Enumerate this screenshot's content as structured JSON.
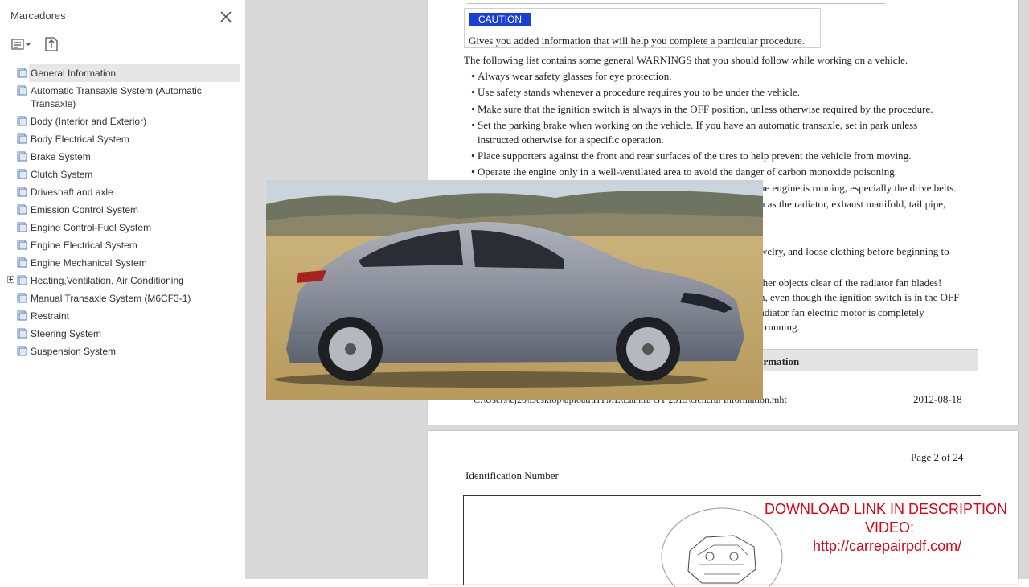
{
  "sidebar": {
    "title": "Marcadores",
    "bookmarks": [
      {
        "label": "General Information",
        "selected": true
      },
      {
        "label": "Automatic Transaxle System (Automatic",
        "label2": "Transaxle)"
      },
      {
        "label": "Body (Interior and Exterior)"
      },
      {
        "label": "Body Electrical System"
      },
      {
        "label": "Brake System"
      },
      {
        "label": "Clutch System"
      },
      {
        "label": "Driveshaft and axle"
      },
      {
        "label": "Emission Control System"
      },
      {
        "label": "Engine Control-Fuel System"
      },
      {
        "label": "Engine Electrical System"
      },
      {
        "label": "Engine Mechanical System"
      },
      {
        "label": "Heating,Ventilation, Air Conditioning",
        "expandable": true
      },
      {
        "label": "Manual Transaxle System (M6CF3-1)"
      },
      {
        "label": "Restraint"
      },
      {
        "label": "Steering System"
      },
      {
        "label": "Suspension System"
      }
    ]
  },
  "page1": {
    "caution_badge": "CAUTION",
    "caution_text": "Gives you added information that will help you complete a particular procedure.",
    "intro": "The following list contains some general WARNINGS that you should follow while working on a vehicle.",
    "bullets": [
      "Always wear safety glasses for eye protection.",
      "Use safety stands whenever a procedure requires you to be under the vehicle.",
      "Make sure that the ignition switch is always in the OFF position, unless otherwise required by the procedure.",
      "Set the parking brake when working on the vehicle. If you have an automatic transaxle, set in park unless",
      "Place supporters against the front and rear surfaces of the tires to help prevent the vehicle from moving.",
      "Operate the engine only in a well-ventilated area to avoid the danger of carbon monoxide poisoning."
    ],
    "bullet4_cont": "instructed otherwise for a specific operation.",
    "partial_lines": [
      "ne engine is running, especially the drive belts.",
      "n as the radiator, exhaust manifold, tail pipe,",
      "welry, and loose clothing before beginning to",
      "ther objects clear of the radiator fan blades!",
      "n, even though the ignition switch is in the OFF",
      "adiator fan electric motor is completely",
      "running."
    ],
    "band_text": "ormation",
    "footer_path": "C:\\Users\\cj20\\Desktop\\upload\\HTML\\Elantra GT 2013\\General Information.mht",
    "footer_date": "2012-08-18"
  },
  "page2": {
    "page_label": "Page 2 of 24",
    "heading": "Identification Number"
  },
  "overlay": {
    "line1": "DOWNLOAD LINK IN DESCRIPTION",
    "line2": "VIDEO:",
    "line3": "http://carrepairpdf.com/",
    "color": "#e3000f"
  }
}
